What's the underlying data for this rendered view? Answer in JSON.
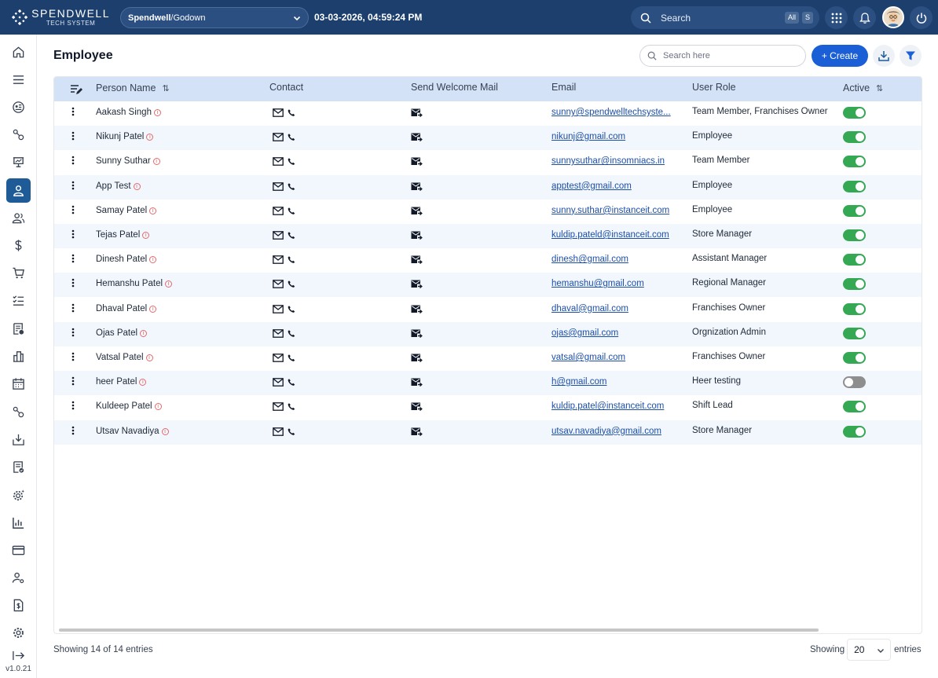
{
  "app": {
    "logo_name": "SPENDWELL",
    "logo_sub": "TECH SYSTEM",
    "org": {
      "company": "Spendwell",
      "separator": " / ",
      "location": "Godown"
    },
    "datetime": "03-03-2026, 04:59:24 PM",
    "search": {
      "label": "Search",
      "kbd_all": "All",
      "kbd_s": "S"
    },
    "version": "v1.0.21"
  },
  "sidebar": {
    "items": [
      {
        "name": "home-icon"
      },
      {
        "name": "menu-icon"
      },
      {
        "name": "dashboard-icon"
      },
      {
        "name": "settings-cog-icon"
      },
      {
        "name": "presentation-icon"
      },
      {
        "name": "person-icon",
        "active": true
      },
      {
        "name": "users-icon"
      },
      {
        "name": "dollar-icon"
      },
      {
        "name": "cart-icon"
      },
      {
        "name": "checklist-icon"
      },
      {
        "name": "report-icon"
      },
      {
        "name": "building-icon"
      },
      {
        "name": "calendar-icon"
      },
      {
        "name": "cogs-icon"
      },
      {
        "name": "download-tray-icon"
      },
      {
        "name": "invoice-check-icon"
      },
      {
        "name": "gear-sparkle-icon"
      },
      {
        "name": "bar-chart-icon"
      },
      {
        "name": "card-icon"
      },
      {
        "name": "user-settings-icon"
      },
      {
        "name": "document-dollar-icon"
      },
      {
        "name": "gear-icon"
      },
      {
        "name": "logout-icon"
      }
    ]
  },
  "page": {
    "title": "Employee",
    "search_placeholder": "Search here",
    "create_label": "+ Create"
  },
  "table": {
    "headers": {
      "name": "Person Name",
      "contact": "Contact",
      "welcome": "Send Welcome Mail",
      "email": "Email",
      "role": "User Role",
      "active": "Active"
    },
    "rows": [
      {
        "name": "Aakash Singh",
        "email": "sunny@spendwelltechsyste...",
        "role": "Team Member, Franchises Owner",
        "active": true
      },
      {
        "name": "Nikunj Patel",
        "email": "nikunj@gmail.com",
        "role": "Employee",
        "active": true
      },
      {
        "name": "Sunny Suthar",
        "email": "sunnysuthar@insomniacs.in",
        "role": "Team Member",
        "active": true
      },
      {
        "name": "App Test",
        "email": "apptest@gmail.com",
        "role": "Employee",
        "active": true
      },
      {
        "name": "Samay Patel",
        "email": "sunny.suthar@instanceit.com",
        "role": "Employee",
        "active": true
      },
      {
        "name": "Tejas Patel",
        "email": "kuldip.pateld@instanceit.com",
        "role": "Store Manager",
        "active": true
      },
      {
        "name": "Dinesh Patel",
        "email": "dinesh@gmail.com",
        "role": "Assistant Manager",
        "active": true
      },
      {
        "name": "Hemanshu Patel",
        "email": "hemanshu@gmail.com",
        "role": "Regional Manager",
        "active": true
      },
      {
        "name": "Dhaval Patel",
        "email": "dhaval@gmail.com",
        "role": "Franchises Owner",
        "active": true
      },
      {
        "name": "Ojas Patel",
        "email": "ojas@gmail.com",
        "role": "Orgnization Admin",
        "active": true
      },
      {
        "name": "Vatsal Patel",
        "email": "vatsal@gmail.com",
        "role": "Franchises Owner",
        "active": true
      },
      {
        "name": "heer Patel",
        "email": "h@gmail.com",
        "role": "Heer testing",
        "active": false
      },
      {
        "name": "Kuldeep Patel",
        "email": "kuldip.patel@instanceit.com",
        "role": "Shift Lead",
        "active": true
      },
      {
        "name": "Utsav Navadiya",
        "email": "utsav.navadiya@gmail.com",
        "role": "Store Manager",
        "active": true
      }
    ]
  },
  "footer": {
    "entries_text": "Showing 14 of 14 entries",
    "showing_label": "Showing",
    "page_size": "20",
    "entries_label": "entries"
  },
  "colors": {
    "topbar": "#1c3f6e",
    "accent": "#1a5fd6",
    "header_row": "#d4e2f7",
    "toggle_on": "#34a853",
    "toggle_off": "#8e8e8e"
  }
}
